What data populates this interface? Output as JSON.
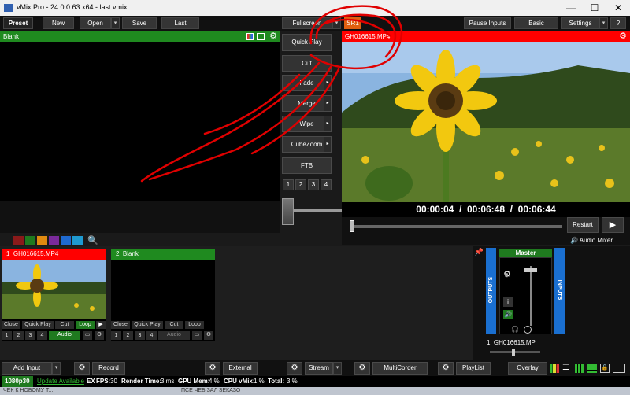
{
  "window": {
    "title": "vMix Pro - 24.0.0.63 x64 - last.vmix",
    "min": "—",
    "max": "☐",
    "close": "✕"
  },
  "menu": {
    "preset": "Preset",
    "new": "New",
    "open": "Open",
    "save": "Save",
    "last": "Last",
    "fullscreen": "Fullscreen",
    "sr1": "SR1",
    "pause_inputs": "Pause Inputs",
    "basic": "Basic",
    "settings": "Settings",
    "help": "?"
  },
  "preview": {
    "title": "Blank"
  },
  "output": {
    "title": "GH016615.MP4",
    "timecode": "00:00:04  /  00:06:48  /  00:06:44",
    "restart": "Restart",
    "audio_mixer": "Audio Mixer"
  },
  "transitions": {
    "quick_play": "Quick Play",
    "cut": "Cut",
    "fade": "Fade",
    "merge": "Merge",
    "wipe": "Wipe",
    "cubezoom": "CubeZoom",
    "ftb": "FTB",
    "nums": [
      "1",
      "2",
      "3",
      "4"
    ]
  },
  "colors": {
    "swatches": [
      "#8b1a1a",
      "#1f7a1f",
      "#e08a10",
      "#7a2a9a",
      "#1f6ad0",
      "#1f9ad0"
    ],
    "program_red": "#ff0000",
    "preview_green": "#1f8a1f",
    "accent_blue": "#1a6fd0"
  },
  "inputs": [
    {
      "number": "1",
      "name": "GH016615.MP4",
      "buttons": [
        "Close",
        "Quick Play",
        "Cut",
        "Loop"
      ],
      "nums": [
        "1",
        "2",
        "3",
        "4"
      ],
      "audio": "Audio"
    },
    {
      "number": "2",
      "name": "Blank",
      "buttons": [
        "Close",
        "Quick Play",
        "Cut",
        "Loop"
      ],
      "nums": [
        "1",
        "2",
        "3",
        "4"
      ],
      "audio": "Audio"
    }
  ],
  "mixer": {
    "master": "Master",
    "outputs": "OUTPUTS",
    "inputs": "INPUTS",
    "channel_number": "1",
    "channel_name": "GH016615.MP",
    "info": "i"
  },
  "bottom_bar": {
    "add_input": "Add Input",
    "record": "Record",
    "external": "External",
    "stream": "Stream",
    "multicorder": "MultiCorder",
    "playlist": "PlayList",
    "overlay": "Overlay"
  },
  "status": {
    "resolution": "1080p30",
    "update": "Update Available",
    "ex": "EX",
    "fps_label": "FPS:",
    "fps": "30",
    "render_label": "Render Time:",
    "render": "3 ms",
    "gpu_label": "GPU Mem:",
    "gpu": "4 %",
    "cpu_label": "CPU vMix:",
    "cpu": "1 %",
    "total_label": "Total:",
    "total": "3 %"
  },
  "taskbar": {
    "left": "ЧЕК К НОБОМУ Т...",
    "mid": "ПСЕ ЧЕБ ЗАЛ ЗЕКАЗО"
  }
}
